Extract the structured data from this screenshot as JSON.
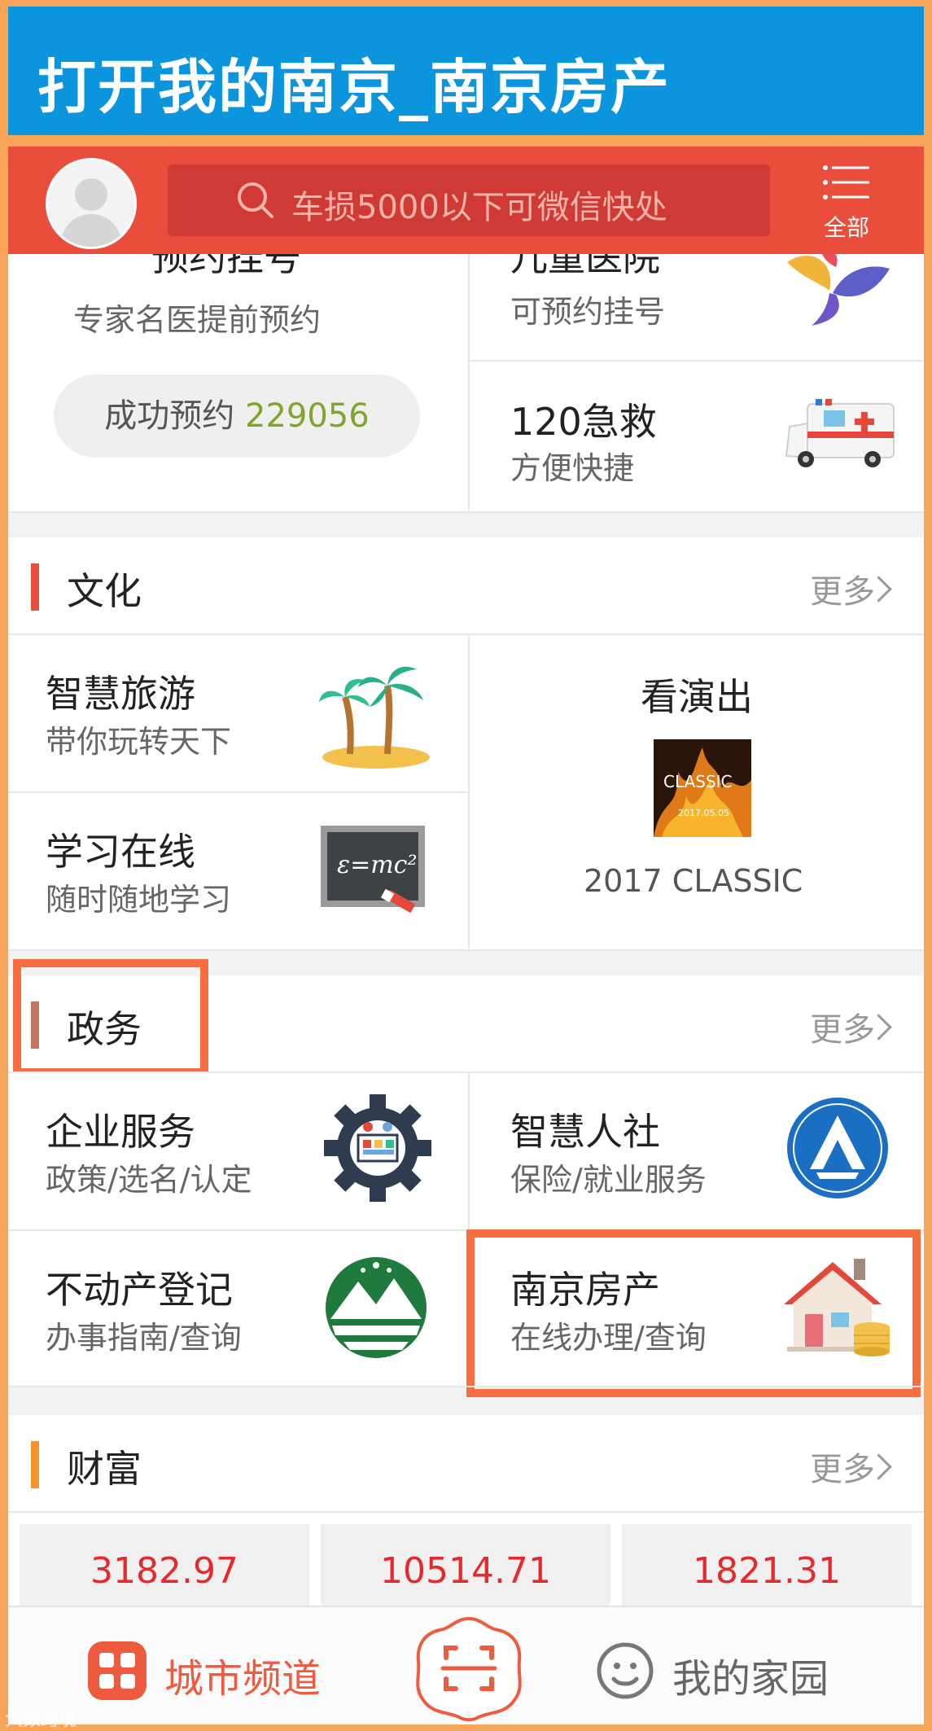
{
  "title": "打开我的南京_南京房产",
  "colors": {
    "accent_red": "#e94e3c",
    "title_blue": "#0b95dc",
    "highlight_orange": "#f56f3f",
    "stock_red": "#e42a2a",
    "count_green": "#7fa52a"
  },
  "header": {
    "search_placeholder": "车损5000以下可微信快处",
    "menu_label": "全部",
    "menu_icon": "menu-icon",
    "avatar_icon": "avatar-icon"
  },
  "medical": {
    "left": {
      "title": "预约挂号",
      "subtitle": "专家名医提前预约",
      "count_prefix": "成功预约 ",
      "count": "229056"
    },
    "right_top": {
      "title": "儿童医院",
      "subtitle": "可预约挂号",
      "icon": "flower-icon"
    },
    "right_bottom": {
      "title": "120急救",
      "subtitle": "方便快捷",
      "icon": "ambulance-icon"
    }
  },
  "culture": {
    "title": "文化",
    "more": "更多",
    "items": [
      {
        "title": "智慧旅游",
        "subtitle": "带你玩转天下",
        "icon": "palm-tree-icon"
      },
      {
        "title": "学习在线",
        "subtitle": "随时随地学习",
        "icon": "blackboard-icon"
      }
    ],
    "show": {
      "title": "看演出",
      "poster_text": "CLASSIC",
      "poster_date": "2017.05.05",
      "caption": "2017 CLASSIC"
    }
  },
  "government": {
    "title": "政务",
    "more": "更多",
    "items": [
      {
        "title": "企业服务",
        "subtitle": "政策/选名/认定",
        "icon": "gear-icon"
      },
      {
        "title": "智慧人社",
        "subtitle": "保险/就业服务",
        "icon": "social-security-icon"
      },
      {
        "title": "不动产登记",
        "subtitle": "办事指南/查询",
        "icon": "mountain-emblem-icon"
      },
      {
        "title": "南京房产",
        "subtitle": "在线办理/查询",
        "icon": "house-icon"
      }
    ]
  },
  "wealth": {
    "title": "财富",
    "more": "更多",
    "values": [
      "3182.97",
      "10514.71",
      "1821.31"
    ]
  },
  "tabbar": {
    "city": "城市频道",
    "mine": "我的家园",
    "scan_icon": "scan-icon"
  },
  "watermark": "大数跨境"
}
